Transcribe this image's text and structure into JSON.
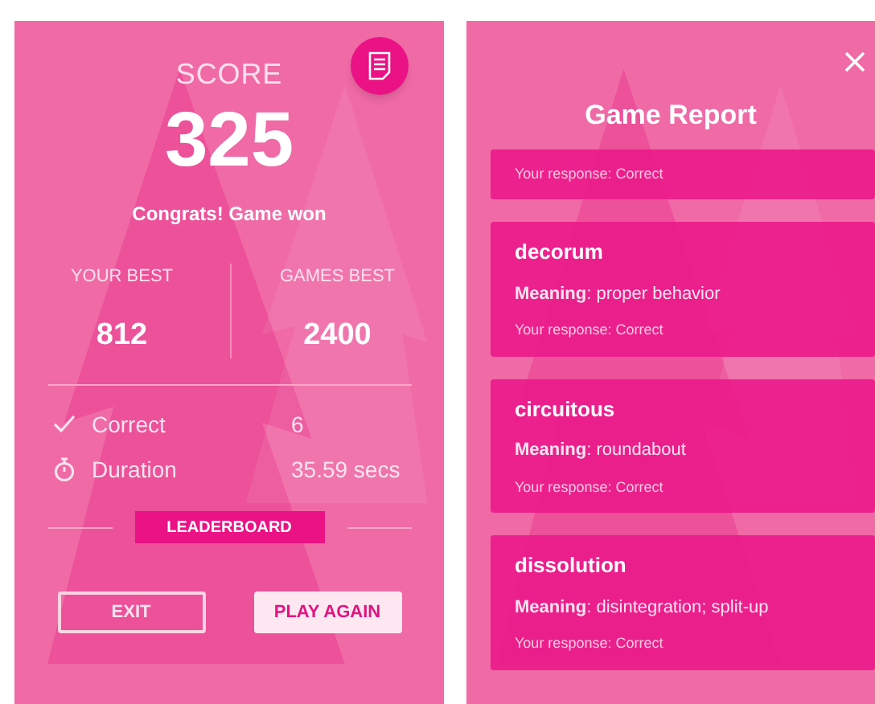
{
  "score_panel": {
    "label": "SCORE",
    "score": "325",
    "message": "Congrats! Game won",
    "bests": [
      {
        "label": "YOUR BEST",
        "value": "812"
      },
      {
        "label": "GAMES BEST",
        "value": "2400"
      }
    ],
    "stats": [
      {
        "kind": "check",
        "label": "Correct",
        "value": "6"
      },
      {
        "kind": "timer",
        "label": "Duration",
        "value": "35.59 secs"
      }
    ],
    "leaderboard": "LEADERBOARD",
    "buttons": [
      {
        "kind": "outline",
        "label": "EXIT"
      },
      {
        "kind": "filled",
        "label": "PLAY AGAIN"
      }
    ]
  },
  "report": {
    "title": "Game Report",
    "cards": [
      {
        "response": "Your response: Correct"
      },
      {
        "word": "decorum",
        "meaning": "**Meaning**: proper behavior",
        "response": "Your response: Correct"
      },
      {
        "word": "circuitous",
        "meaning": "**Meaning**: roundabout",
        "response": "Your response: Correct"
      },
      {
        "word": "dissolution",
        "meaning": "**Meaning**: disintegration; split-up",
        "response": "Your response: Correct"
      }
    ]
  }
}
